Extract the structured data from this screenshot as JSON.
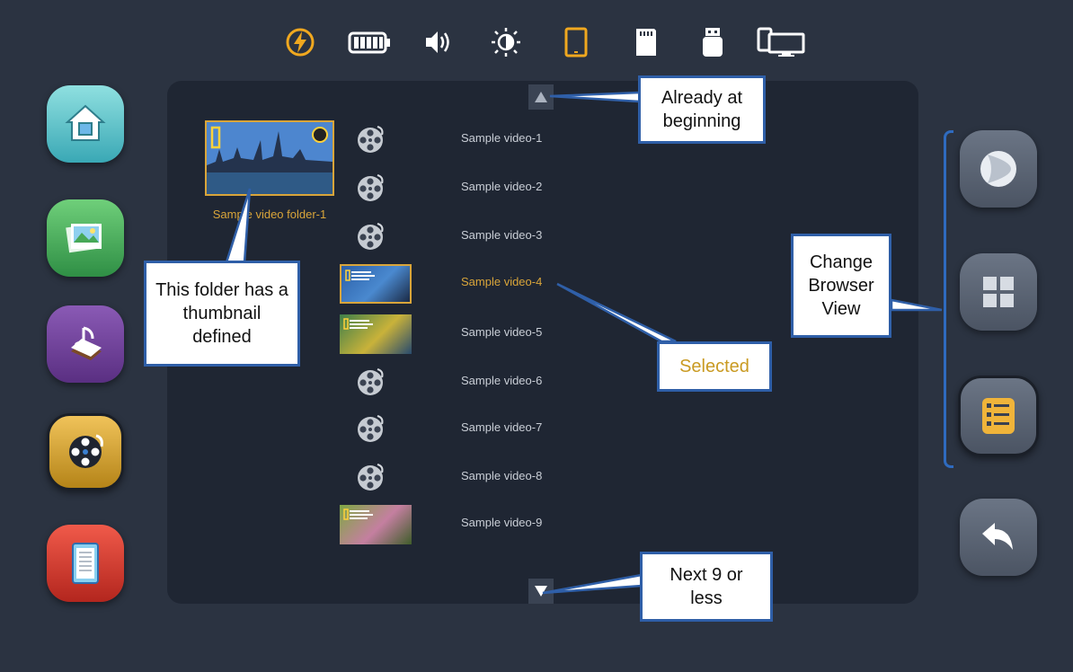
{
  "status_bar": {
    "icons": [
      "charging-icon",
      "battery-icon",
      "volume-icon",
      "brightness-icon",
      "tablet-icon",
      "sd-card-icon",
      "usb-drive-icon",
      "screen-mirror-icon"
    ],
    "accent": "#f0a81f"
  },
  "left_nav": {
    "items": [
      "home",
      "gallery",
      "music",
      "video",
      "documents"
    ],
    "active": "video"
  },
  "browser": {
    "folder": {
      "caption": "Sample video folder-1"
    },
    "items": [
      {
        "label": "Sample video-1",
        "kind": "icon"
      },
      {
        "label": "Sample video-2",
        "kind": "icon"
      },
      {
        "label": "Sample video-3",
        "kind": "icon"
      },
      {
        "label": "Sample video-4",
        "kind": "thumb",
        "selected": true
      },
      {
        "label": "Sample video-5",
        "kind": "thumb"
      },
      {
        "label": "Sample video-6",
        "kind": "icon"
      },
      {
        "label": "Sample video-7",
        "kind": "icon"
      },
      {
        "label": "Sample video-8",
        "kind": "icon"
      },
      {
        "label": "Sample video-9",
        "kind": "thumb"
      }
    ]
  },
  "right_nav": {
    "items": [
      "play-view",
      "grid-view",
      "list-view",
      "back"
    ],
    "active": "list-view"
  },
  "callouts": {
    "beginning": "Already at beginning",
    "thumbnail": "This folder has a thumbnail defined",
    "selected": "Selected",
    "browser_view": "Change Browser View",
    "next": "Next 9 or less"
  },
  "colors": {
    "background": "#2b3341",
    "panel": "#1f2633",
    "accent": "#d9a53a",
    "callout_border": "#2f5fa8"
  }
}
